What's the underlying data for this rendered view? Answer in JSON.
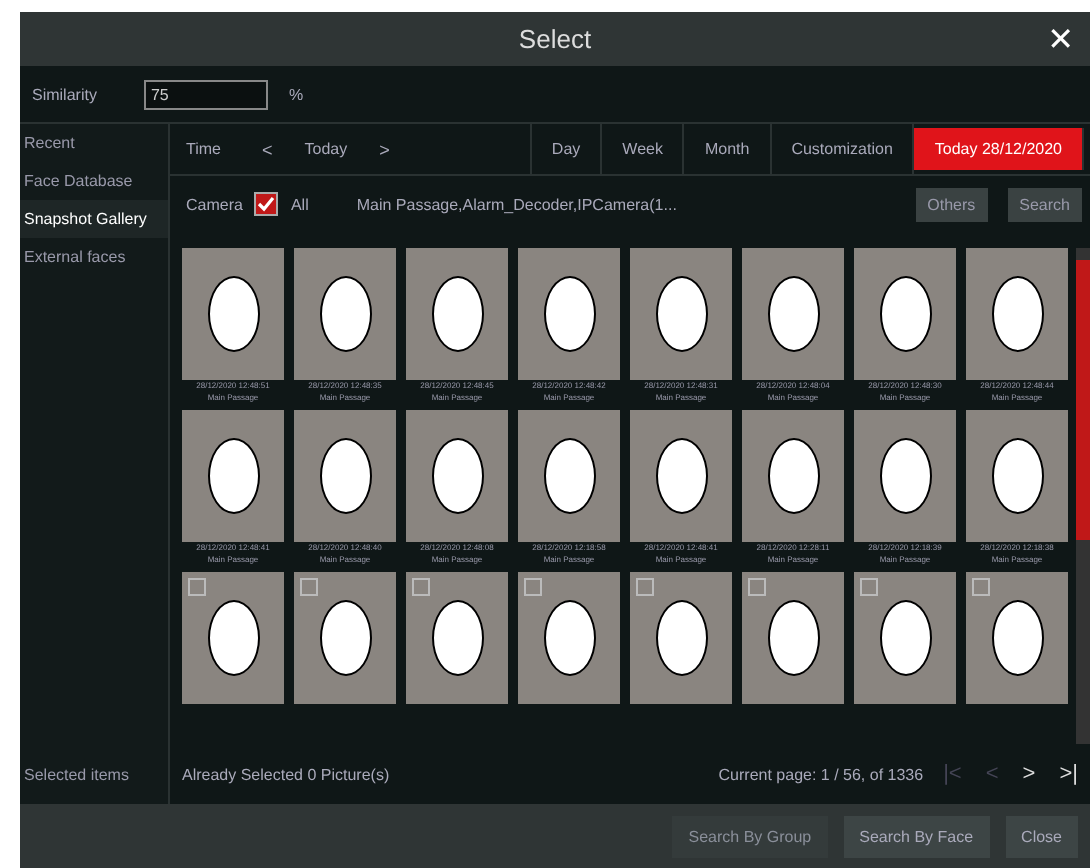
{
  "window": {
    "title": "Select",
    "close": "✕"
  },
  "similarity": {
    "label": "Similarity",
    "value": "75",
    "unit": "%"
  },
  "sidebar": {
    "items": [
      {
        "label": "Recent",
        "selected": false
      },
      {
        "label": "Face Database",
        "selected": false
      },
      {
        "label": "Snapshot Gallery",
        "selected": true
      },
      {
        "label": "External faces",
        "selected": false
      }
    ],
    "footer": "Selected items"
  },
  "time": {
    "label": "Time",
    "prev": "<",
    "value": "Today",
    "next": ">",
    "ranges": [
      {
        "label": "Day",
        "selected": false
      },
      {
        "label": "Week",
        "selected": false
      },
      {
        "label": "Month",
        "selected": false
      },
      {
        "label": "Customization",
        "selected": false
      },
      {
        "label": "Today 28/12/2020",
        "selected": true
      }
    ]
  },
  "camera": {
    "label": "Camera",
    "all_checked": true,
    "all_label": "All",
    "cameras": "Main Passage,Alarm_Decoder,IPCamera(1...",
    "buttons": [
      "Others",
      "Search"
    ]
  },
  "snapshots": [
    {
      "time": "28/12/2020 12:48:51",
      "place": "Main Passage"
    },
    {
      "time": "28/12/2020 12:48:35",
      "place": "Main Passage"
    },
    {
      "time": "28/12/2020 12:48:45",
      "place": "Main Passage"
    },
    {
      "time": "28/12/2020 12:48:42",
      "place": "Main Passage"
    },
    {
      "time": "28/12/2020 12:48:31",
      "place": "Main Passage"
    },
    {
      "time": "28/12/2020 12:48:04",
      "place": "Main Passage"
    },
    {
      "time": "28/12/2020 12:48:30",
      "place": "Main Passage"
    },
    {
      "time": "28/12/2020 12:48:44",
      "place": "Main Passage"
    },
    {
      "time": "28/12/2020 12:48:41",
      "place": "Main Passage"
    },
    {
      "time": "28/12/2020 12:48:40",
      "place": "Main Passage"
    },
    {
      "time": "28/12/2020 12:48:08",
      "place": "Main Passage"
    },
    {
      "time": "28/12/2020 12:18:58",
      "place": "Main Passage"
    },
    {
      "time": "28/12/2020 12:48:41",
      "place": "Main Passage"
    },
    {
      "time": "28/12/2020 12:28:11",
      "place": "Main Passage"
    },
    {
      "time": "28/12/2020 12:18:39",
      "place": "Main Passage"
    },
    {
      "time": "28/12/2020 12:18:38",
      "place": "Main Passage"
    },
    {
      "checked": false
    },
    {
      "checked": false
    },
    {
      "checked": false
    },
    {
      "checked": false
    },
    {
      "checked": false
    },
    {
      "checked": false
    },
    {
      "checked": false
    },
    {
      "checked": false
    }
  ],
  "status": {
    "selected": "Already Selected 0 Picture(s)",
    "page": "Current page: 1 / 56, of 1336",
    "nav": [
      "|<",
      "<",
      ">",
      ">|"
    ]
  },
  "buttons": [
    {
      "label": "Search By Group",
      "disabled": true
    },
    {
      "label": "Search By Face",
      "disabled": false
    },
    {
      "label": "Close",
      "disabled": false
    }
  ]
}
